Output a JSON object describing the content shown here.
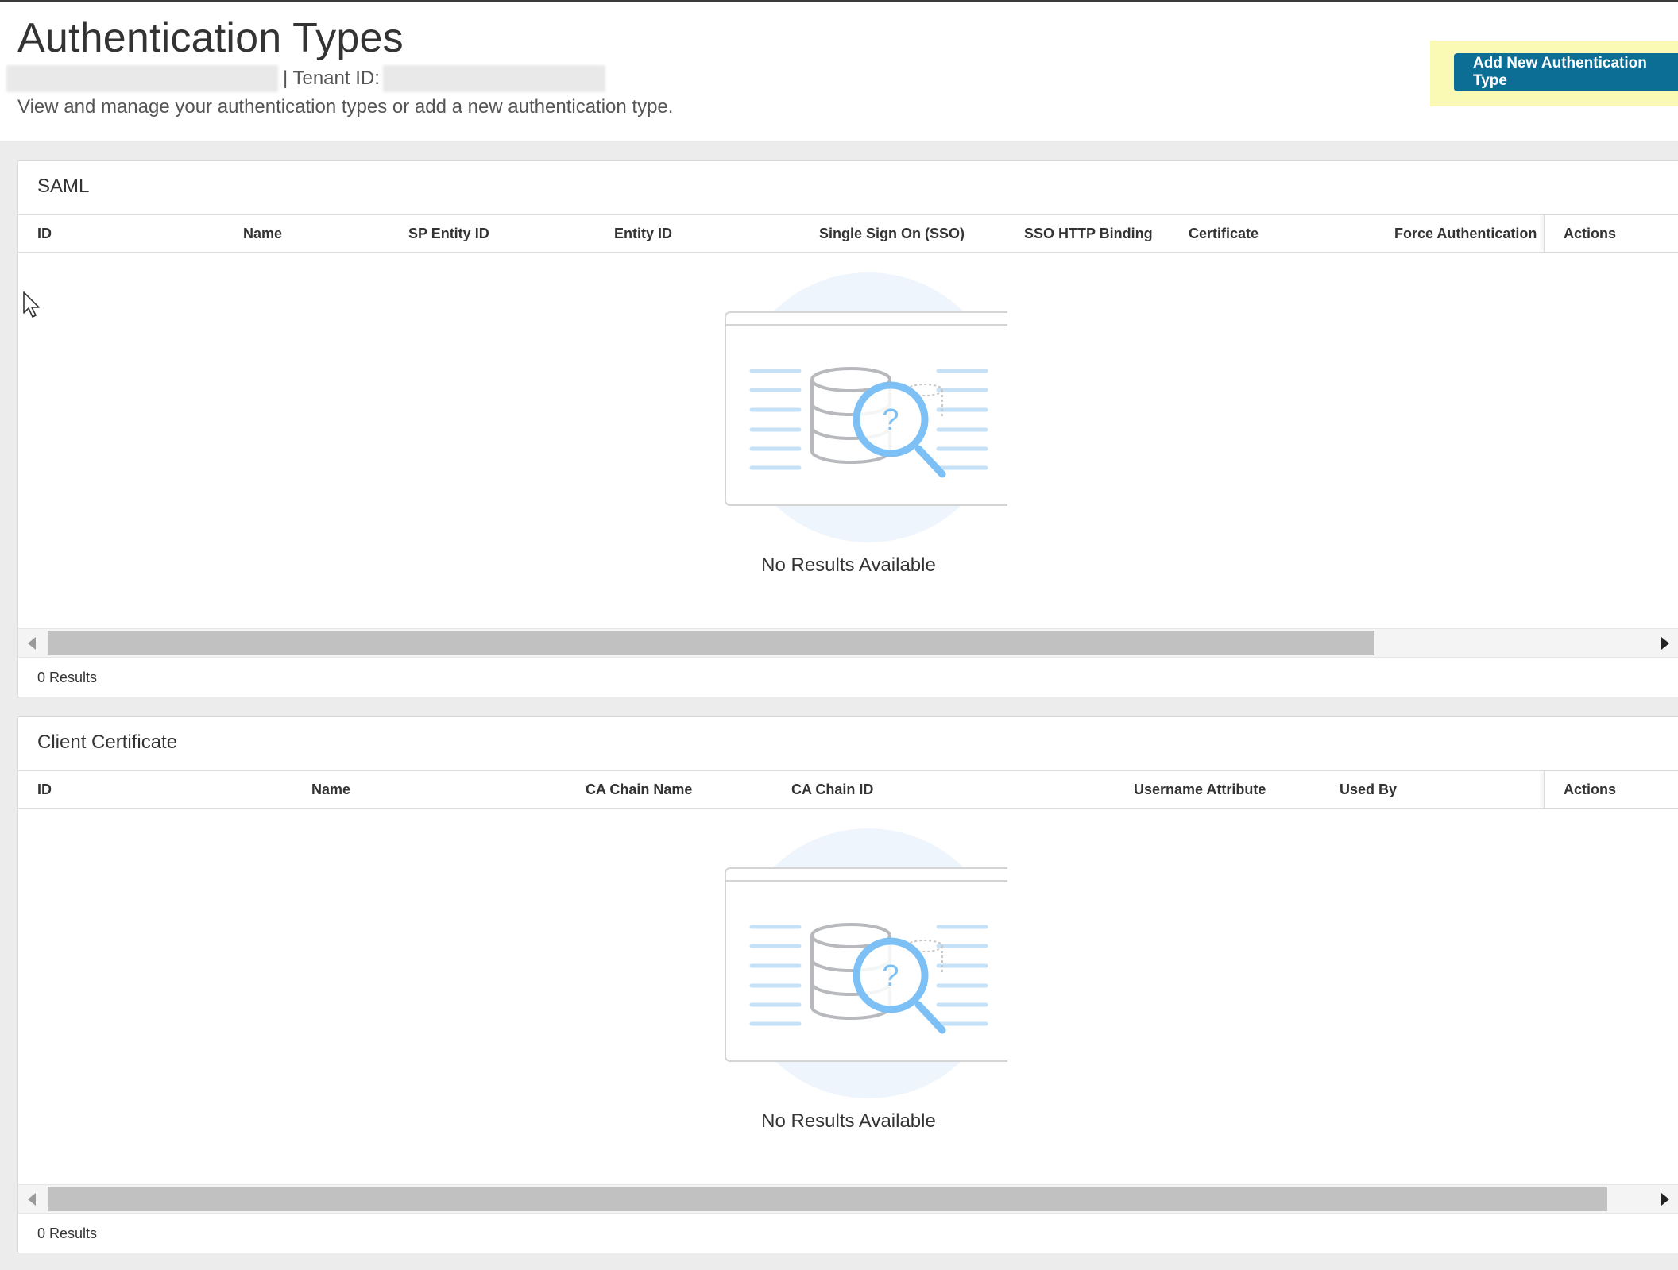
{
  "header": {
    "title": "Authentication Types",
    "tenant_label": "| Tenant ID:",
    "subtitle": "View and manage your authentication types or add a new authentication type.",
    "add_button": "Add New Authentication Type"
  },
  "saml": {
    "title": "SAML",
    "columns": [
      "ID",
      "Name",
      "SP Entity ID",
      "Entity ID",
      "Single Sign On (SSO)",
      "SSO HTTP Binding",
      "Certificate",
      "Force Authentication"
    ],
    "actions": "Actions",
    "empty_text": "No Results Available",
    "results": "0 Results"
  },
  "client_certificate": {
    "title": "Client Certificate",
    "columns": [
      "ID",
      "Name",
      "CA Chain Name",
      "CA Chain ID",
      "Username Attribute",
      "Used By"
    ],
    "actions": "Actions",
    "empty_text": "No Results Available",
    "results": "0 Results"
  },
  "colors": {
    "primary_button": "#0d6e95",
    "highlight": "#fafab4",
    "illustration_blue": "#7cc0f5"
  },
  "icons": [
    "empty-database-search-icon",
    "scroll-left-icon",
    "scroll-right-icon",
    "mouse-cursor-icon"
  ]
}
